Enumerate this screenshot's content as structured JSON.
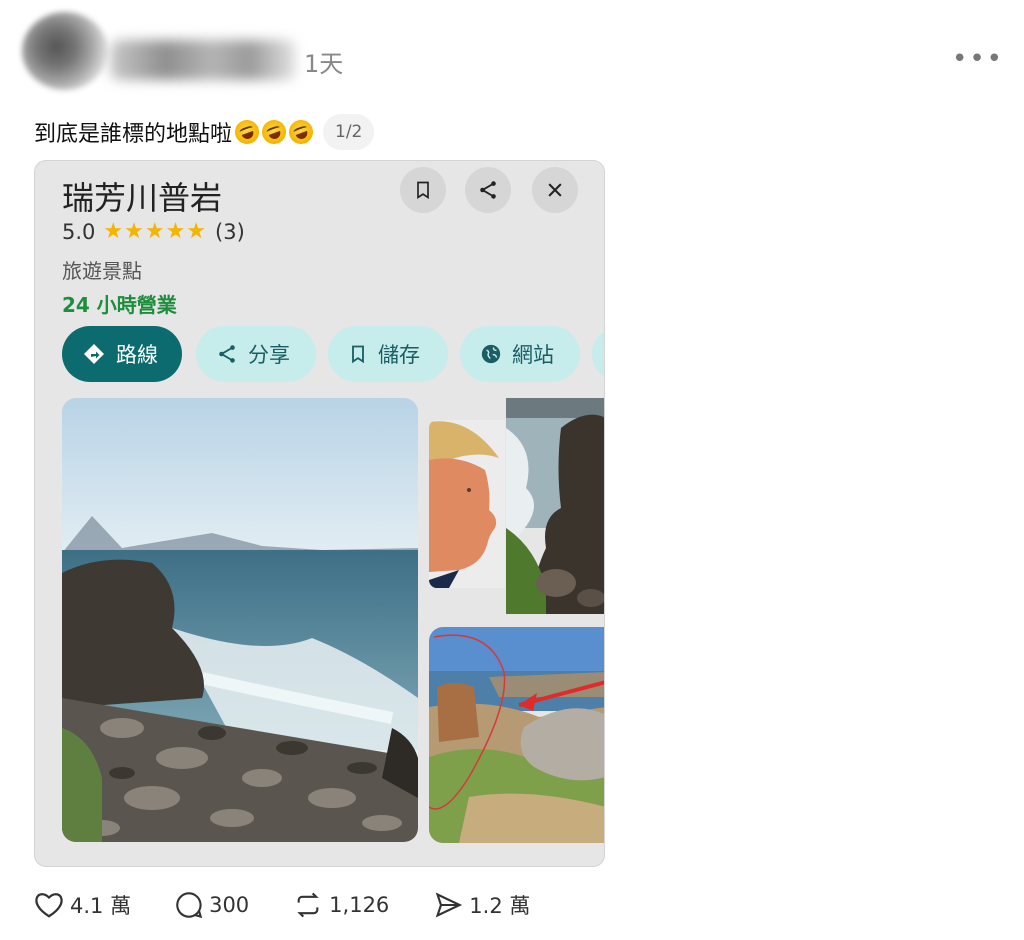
{
  "post": {
    "time": "1天",
    "text": "到底是誰標的地點啦",
    "emoji_count": 3,
    "pager": "1/2"
  },
  "place_card": {
    "title": "瑞芳川普岩",
    "rating": "5.0",
    "stars": "★★★★★",
    "review_count": "(3)",
    "category": "旅遊景點",
    "hours": "24 小時營業",
    "actions": [
      {
        "label": "路線",
        "icon": "directions-icon"
      },
      {
        "label": "分享",
        "icon": "share-icon"
      },
      {
        "label": "儲存",
        "icon": "bookmark-icon"
      },
      {
        "label": "網站",
        "icon": "globe-icon"
      }
    ]
  },
  "footer": {
    "likes": "4.1 萬",
    "comments": "300",
    "reposts": "1,126",
    "shares": "1.2 萬"
  },
  "colors": {
    "primary_action": "#0b6b6f",
    "secondary_action": "#c7ecec",
    "open_green": "#1e8e3e",
    "star": "#f5b400"
  }
}
